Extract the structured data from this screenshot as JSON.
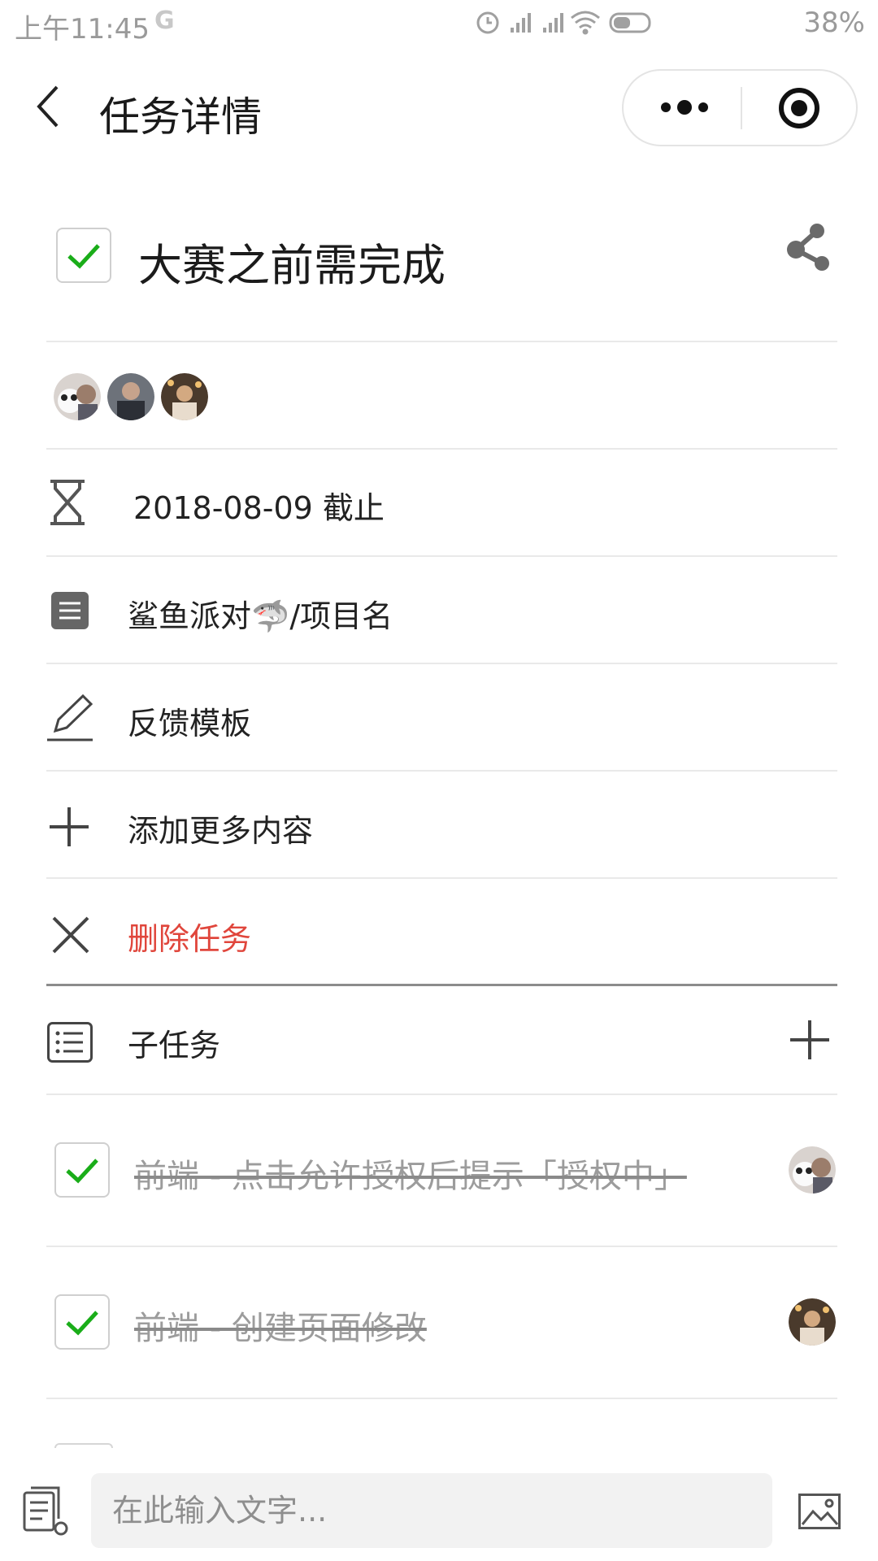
{
  "status_bar": {
    "time": "上午11:45",
    "google_mark": "G",
    "battery": "38%"
  },
  "nav": {
    "title": "任务详情"
  },
  "task": {
    "title": "大赛之前需完成",
    "completed": true,
    "deadline": "2018-08-09 截止",
    "project": "鲨鱼派对🦈/项目名",
    "feedback": "反馈模板",
    "add_more": "添加更多内容",
    "delete": "删除任务",
    "delete_color": "#e0463c"
  },
  "subtasks": {
    "label": "子任务",
    "items": [
      {
        "text": "前端 - 点击允许授权后提示「授权中」",
        "completed": true
      },
      {
        "text": "前端 - 创建页面修改",
        "completed": true
      }
    ]
  },
  "bottom": {
    "placeholder": "在此输入文字..."
  },
  "colors": {
    "check": "#1aad19",
    "accent_red": "#e0463c",
    "divider": "#e9e9e9"
  }
}
